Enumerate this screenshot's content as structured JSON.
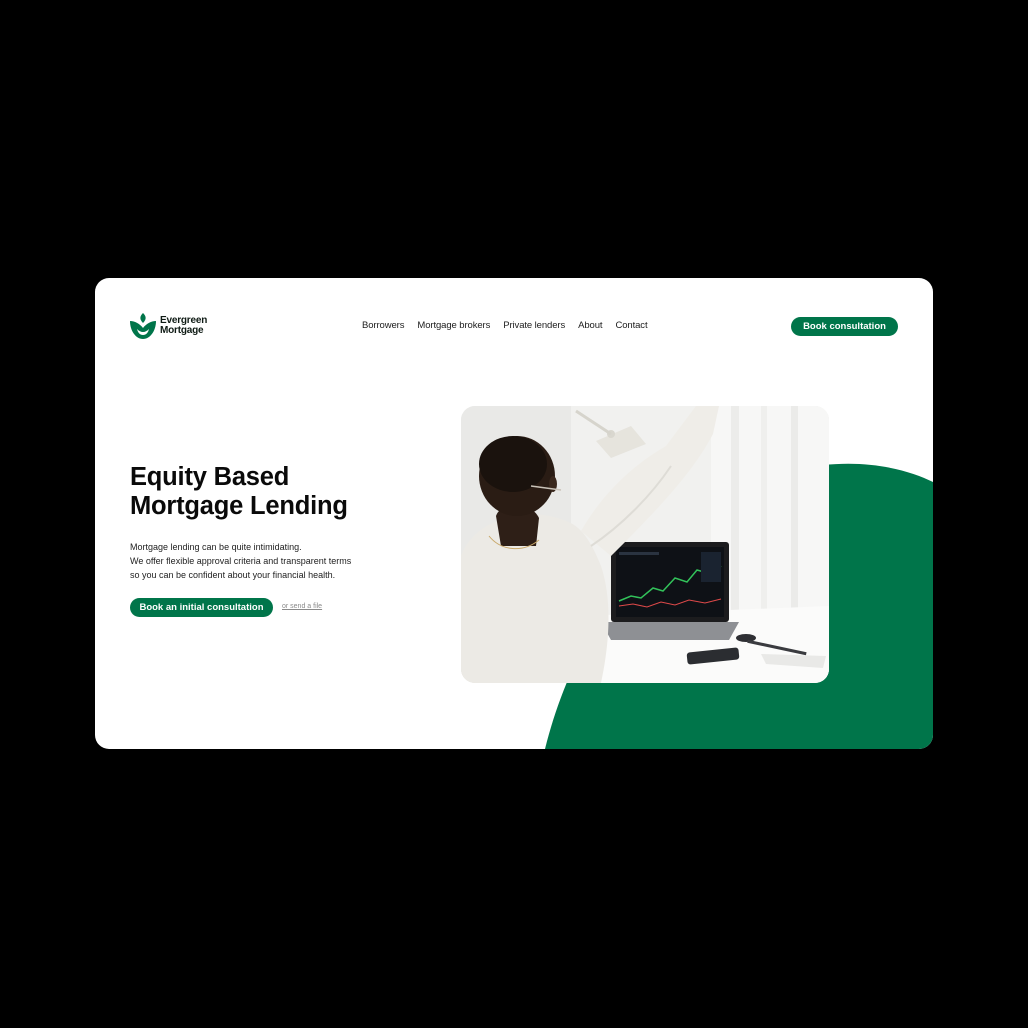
{
  "brand": {
    "name_line1": "Evergreen",
    "name_line2": "Mortgage",
    "accent_color": "#00754a",
    "logo_icon": "leaf-drop-icon"
  },
  "nav": {
    "items": [
      {
        "label": "Borrowers"
      },
      {
        "label": "Mortgage brokers"
      },
      {
        "label": "Private lenders"
      },
      {
        "label": "About"
      },
      {
        "label": "Contact"
      }
    ],
    "cta_label": "Book consultation"
  },
  "hero": {
    "title_line1": "Equity Based",
    "title_line2": "Mortgage Lending",
    "desc_line1": "Mortgage lending can be quite intimidating.",
    "desc_line2": "We offer flexible approval criteria and transparent terms",
    "desc_line3": "so you can be confident about your financial health.",
    "cta_label": "Book an initial consultation",
    "secondary_link": "or send a file"
  }
}
